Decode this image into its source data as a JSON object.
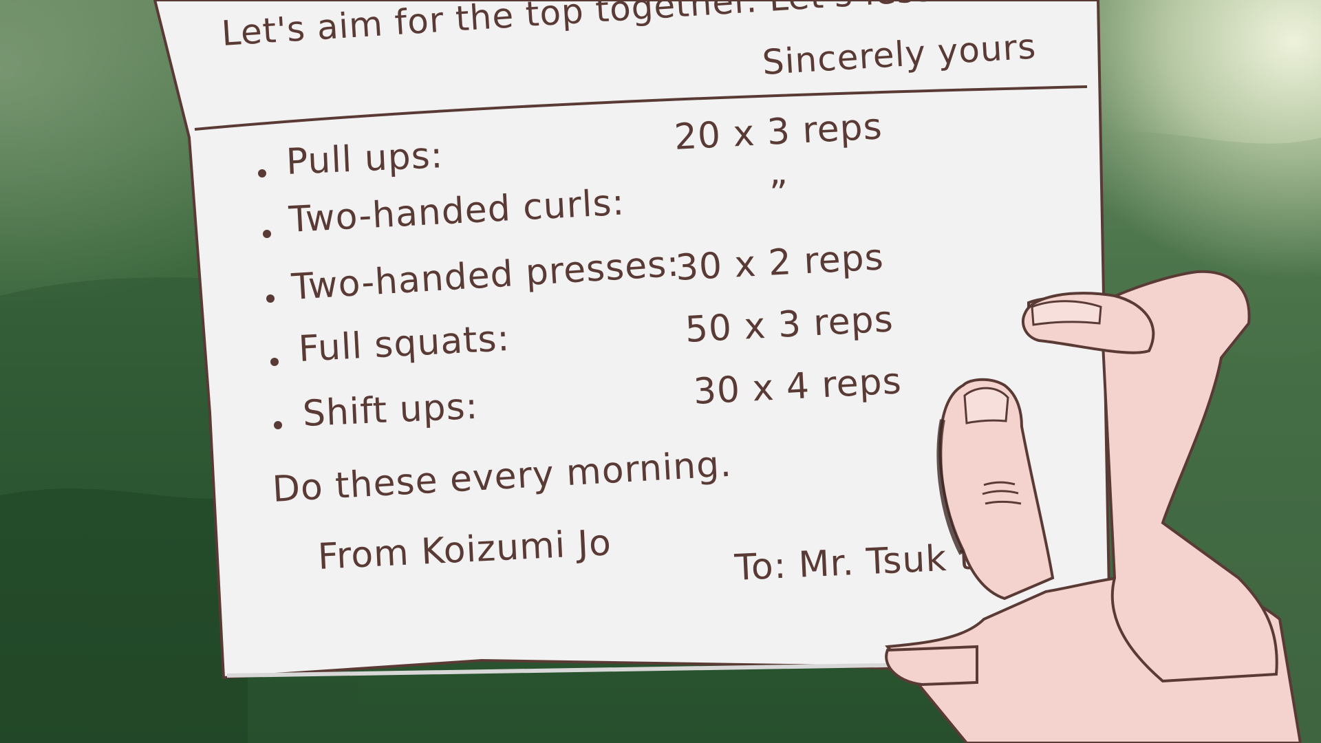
{
  "note": {
    "intro_line": "Let's aim for the top together. Let's lesson!",
    "signoff": "Sincerely yours",
    "exercises": [
      {
        "name": "Pull ups:",
        "value": "20  x 3 reps"
      },
      {
        "name": "Two-handed curls:",
        "value": "”"
      },
      {
        "name": "Two-handed presses:",
        "value": "30  x 2 reps"
      },
      {
        "name": "Full squats:",
        "value": "50  x 3 reps"
      },
      {
        "name": "Shift ups:",
        "value": "30  x 4 reps"
      }
    ],
    "closing": "Do these every morning.",
    "from": "From Koizumi Jo",
    "to": "To: Mr. Tsuk    to"
  },
  "colors": {
    "ink": "#5a3a35",
    "paper": "#f2f2f2",
    "skin": "#f4d3cf",
    "background": "#2f5a35"
  }
}
